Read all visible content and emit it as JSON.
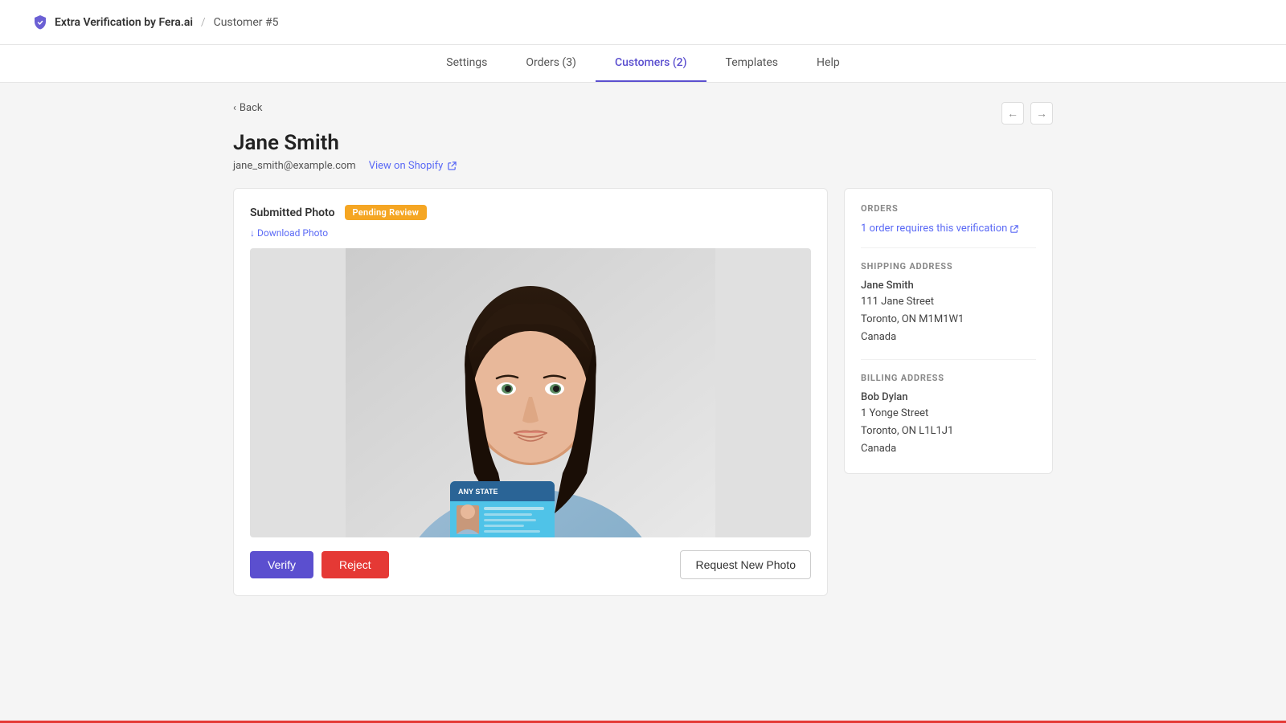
{
  "header": {
    "app_name": "Extra Verification by Fera.ai",
    "separator": "/",
    "page_context": "Customer #5"
  },
  "nav": {
    "items": [
      {
        "id": "settings",
        "label": "Settings",
        "active": false
      },
      {
        "id": "orders",
        "label": "Orders (3)",
        "active": false
      },
      {
        "id": "customers",
        "label": "Customers (2)",
        "active": true
      },
      {
        "id": "templates",
        "label": "Templates",
        "active": false
      },
      {
        "id": "help",
        "label": "Help",
        "active": false
      }
    ]
  },
  "back_link": "Back",
  "customer": {
    "name": "Jane Smith",
    "email": "jane_smith@example.com",
    "view_shopify_label": "View on Shopify"
  },
  "photo_section": {
    "label": "Submitted Photo",
    "status_badge": "Pending Review",
    "download_label": "Download Photo",
    "verify_button": "Verify",
    "reject_button": "Reject",
    "request_new_photo_button": "Request New Photo"
  },
  "orders_section": {
    "title": "ORDERS",
    "link_text": "1 order requires this verification"
  },
  "shipping_address": {
    "title": "SHIPPING ADDRESS",
    "name": "Jane Smith",
    "street": "111 Jane Street",
    "city_state_zip": "Toronto, ON M1M1W1",
    "country": "Canada"
  },
  "billing_address": {
    "title": "BILLING ADDRESS",
    "name": "Bob Dylan",
    "street": "1 Yonge Street",
    "city_state_zip": "Toronto, ON L1L1J1",
    "country": "Canada"
  }
}
